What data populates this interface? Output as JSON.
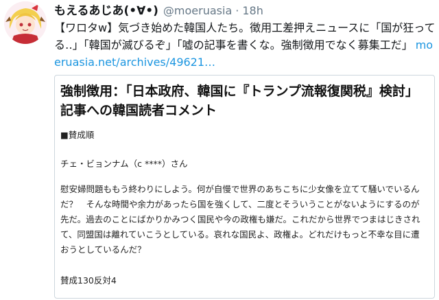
{
  "tweet": {
    "display_name": "もえるあじあ(•∀•)",
    "handle": "@moeruasia",
    "separator": "·",
    "time": "18h",
    "text": "【ワロタw】気づき始めた韓国人たち。徴用工差押えニュースに「国が狂ってる‥」「韓国が滅びるぞ」「嘘の記事を書くな。強制徴用でなく募集工だ」",
    "link": "moeruasia.net/archives/49621…"
  },
  "card": {
    "title": "強制徴用：「日本政府、韓国に『トランプ流報復関税』検討」記事への韓国読者コメント",
    "section_label": "■賛成順",
    "commenter": "チェ・ビョンナム（c ****）さん",
    "comment": "慰安婦問題ももう終わりにしよう。何が自慢で世界のあちこちに少女像を立てて騒いでいるんだ？　そんな時間や余力があったら国を強くして、二度とそういうことがないようにするのが先だ。過去のことにばかりかみつく国民や今の政権も嫌だ。これだから世界でつまはじきされて、同盟国は離れていこうとしている。哀れな国民よ、政権よ。どれだけもっと不幸な目に遭おうとしているんだ？",
    "votes": "賛成130反対4"
  },
  "colors": {
    "text": "#14171a",
    "secondary": "#657786",
    "link": "#1b95e0",
    "card_border": "#ccd6dd"
  }
}
